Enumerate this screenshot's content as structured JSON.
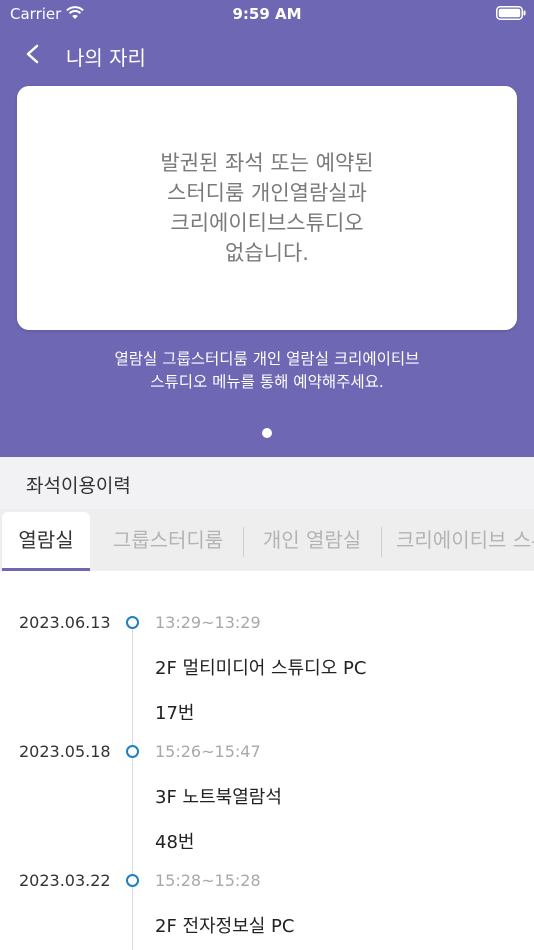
{
  "status_bar": {
    "carrier": "Carrier",
    "time": "9:59 AM"
  },
  "nav": {
    "title": "나의 자리"
  },
  "seat_card": {
    "message": "발권된 좌석 또는 예약된\n스터디룸 개인열람실과\n크리에이티브스튜디오\n없습니다."
  },
  "hero_note": "열람실 그룹스터디룸 개인 열람실 크리에이티브\n스튜디오 메뉴를 통해 예약해주세요.",
  "history": {
    "title": "좌석이용이력",
    "tabs": [
      {
        "label": "열람실"
      },
      {
        "label": "그룹스터디룸"
      },
      {
        "label": "개인 열람실"
      },
      {
        "label": "크리에이티브 스튜디오"
      }
    ],
    "entries": [
      {
        "date": "2023.06.13",
        "time": "13:29~13:29",
        "room": "2F 멀티미디어 스튜디오 PC",
        "seat": "17번"
      },
      {
        "date": "2023.05.18",
        "time": "15:26~15:47",
        "room": "3F 노트북열람석",
        "seat": "48번"
      },
      {
        "date": "2023.03.22",
        "time": "15:28~15:28",
        "room": "2F 전자정보실 PC",
        "seat": ""
      }
    ]
  },
  "colors": {
    "primary": "#6e68b4",
    "timeline_dot": "#1f7fc4"
  }
}
